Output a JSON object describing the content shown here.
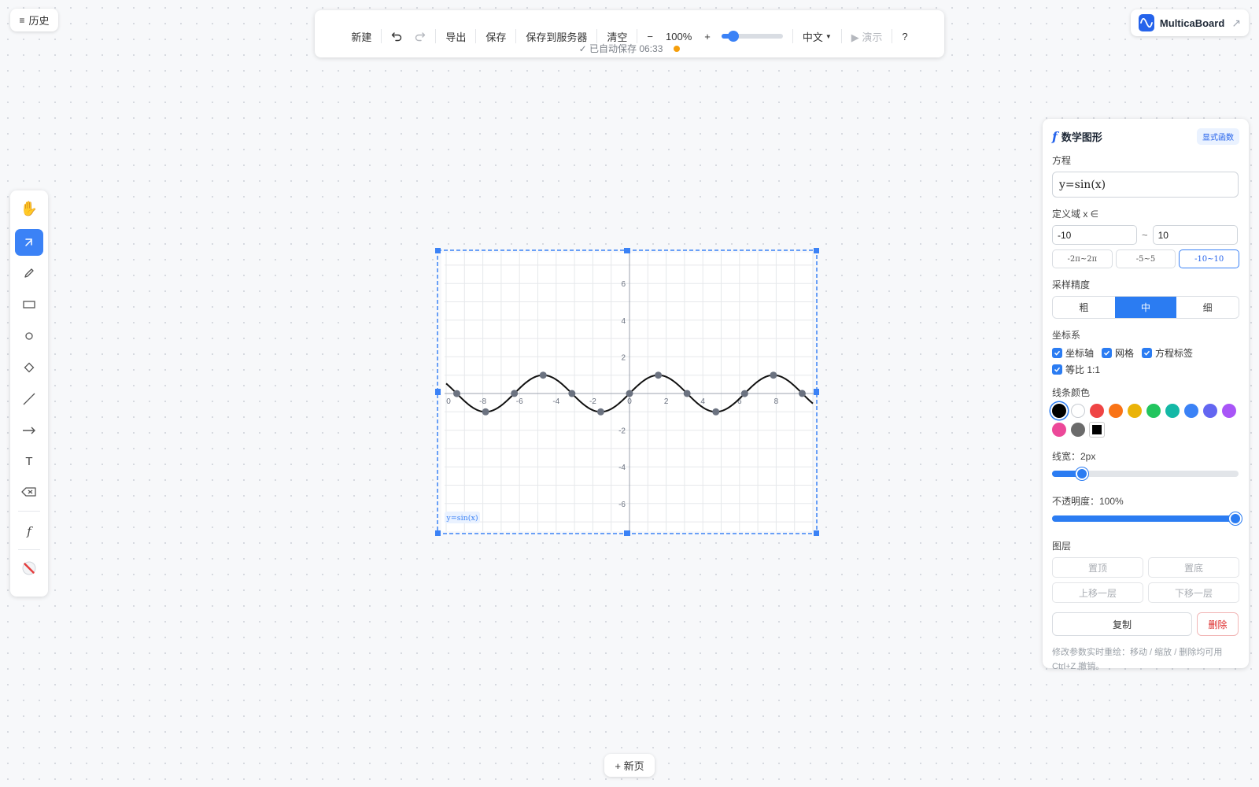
{
  "history": {
    "icon": "menu-icon",
    "label": "历史"
  },
  "toolbar": {
    "new": "新建",
    "undo_icon": "undo-icon",
    "redo_icon": "redo-icon",
    "export": "导出",
    "save": "保存",
    "save_server": "保存到服务器",
    "clear": "清空",
    "zoom_out": "−",
    "zoom": "100%",
    "zoom_in": "+",
    "zoom_level": 0.1,
    "language": "中文",
    "present": "▶ 演示",
    "help": "?",
    "autosave": "✓ 已自动保存 06:33",
    "autosave_dot_color": "#f59e0b"
  },
  "brand": {
    "name": "MulticaBoard",
    "external_icon": "↗"
  },
  "tools": [
    {
      "name": "hand",
      "icon": "hand-icon"
    },
    {
      "name": "select",
      "icon": "select-icon",
      "active": true
    },
    {
      "name": "pencil",
      "icon": "pencil-icon"
    },
    {
      "name": "rectangle",
      "icon": "rectangle-icon"
    },
    {
      "name": "ellipse",
      "icon": "ellipse-icon"
    },
    {
      "name": "diamond",
      "icon": "diamond-icon"
    },
    {
      "name": "line",
      "icon": "line-icon"
    },
    {
      "name": "arrow",
      "icon": "arrow-icon"
    },
    {
      "name": "text",
      "icon": "text-icon",
      "glyph": "T"
    },
    {
      "name": "eraser",
      "icon": "eraser-icon"
    },
    {
      "name": "function",
      "icon": "function-icon",
      "glyph": "f"
    },
    {
      "name": "laser",
      "icon": "laser-icon"
    }
  ],
  "chart_data": {
    "type": "line",
    "function": "sin",
    "equation_label": "y=sin(x)",
    "xlim": [
      -10,
      10
    ],
    "ylim": [
      -7.5,
      7.5
    ],
    "x_ticks": [
      0,
      -8,
      -6,
      -4,
      -2,
      0,
      2,
      4,
      6,
      8
    ],
    "x_tick_labels": [
      "0",
      "-8",
      "-6",
      "-4",
      "-2",
      "0",
      "2",
      "4",
      "6",
      "8"
    ],
    "y_ticks": [
      6,
      4,
      2,
      -2,
      -4,
      -6
    ],
    "y_tick_labels": [
      "6",
      "4",
      "2",
      "-2",
      "-4",
      "-6"
    ],
    "grid": true,
    "axes": true,
    "equal_aspect": true,
    "line_color": "#111111",
    "point_color": "#6b7280",
    "key_points_x": [
      -9.42,
      -7.85,
      -6.28,
      -4.71,
      -3.14,
      -1.57,
      0,
      1.57,
      3.14,
      4.71,
      6.28,
      7.85,
      9.42
    ],
    "selection_color": "#3b82f6"
  },
  "newpage": {
    "label": "+ 新页"
  },
  "panel": {
    "icon": "function-icon",
    "title": "数学图形",
    "badge": "显式函数",
    "equation_label": "方程",
    "equation": "y=sin(x)",
    "domain_label": "定义域 x ∈",
    "domain_min": "-10",
    "domain_max": "10",
    "tilde": "~",
    "presets": [
      "-2π~2π",
      "-5~5",
      "-10~10"
    ],
    "precision_label": "采样精度",
    "precision_options": [
      "粗",
      "中",
      "细"
    ],
    "coord_label": "坐标系",
    "coord_options": [
      "坐标轴",
      "网格",
      "方程标签",
      "等比 1:1"
    ],
    "color_label": "线条颜色",
    "colors": [
      "#000000",
      "#ffffff",
      "#ef4444",
      "#f97316",
      "#eab308",
      "#22c55e",
      "#14b8a6",
      "#3b82f6",
      "#6366f1",
      "#a855f7",
      "#ec4899",
      "#6b6b6b",
      "#000000"
    ],
    "width_label": "线宽：2px",
    "width_value": 2,
    "width_fraction": 0.16,
    "opacity_label": "不透明度：100%",
    "opacity_fraction": 1,
    "layer_label": "图层",
    "layer_buttons": [
      "置顶",
      "置底",
      "上移一层",
      "下移一层"
    ],
    "copy": "复制",
    "delete": "删除",
    "hint": "修改参数实时重绘：移动 / 缩放 / 删除均可用 Ctrl+Z 撤销。"
  }
}
